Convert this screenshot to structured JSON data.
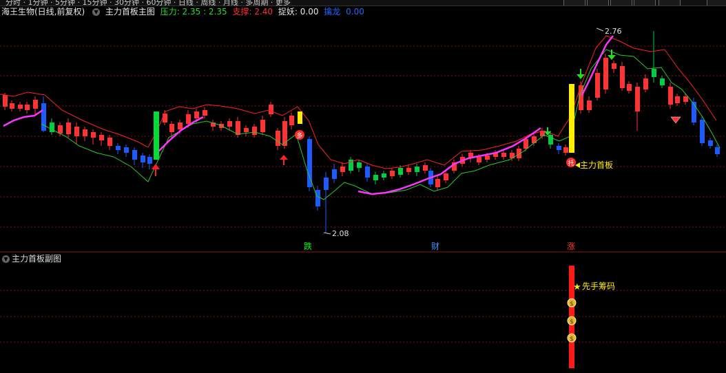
{
  "header": {
    "stock_name": "海王生物(日线,前复权)",
    "main_indicator": "主力首板主图",
    "pressure_label": "压力: 2.35 : 2.35",
    "support_label": "支撑: 2.40",
    "catch_label": "捉妖: 0.00",
    "dragon_label": "擒龙",
    "dragon_value": "0.00"
  },
  "main_chart": {
    "high_label": "2.76",
    "low_label": "2.08",
    "annotation_first_board": "主力首板",
    "badge_duo": "多",
    "badge_tuo": "托",
    "bottom_marks": [
      {
        "text": "跌",
        "color": "#00ff00"
      },
      {
        "text": "财",
        "color": "#3399ff"
      },
      {
        "text": "涨",
        "color": "#ff3333"
      }
    ]
  },
  "sub_chart": {
    "title": "主力首板副图",
    "annotation": "先手筹码",
    "star": "★",
    "coin_symbol": "$"
  },
  "colors": {
    "up": "#ff3333",
    "down": "#00e5ff",
    "down_blue": "#1e5bff",
    "up_green": "#00cc44",
    "pressure": "#ff2020",
    "support": "#22cc22",
    "magenta": "#ff33ff",
    "yellow": "#ffee00"
  }
}
